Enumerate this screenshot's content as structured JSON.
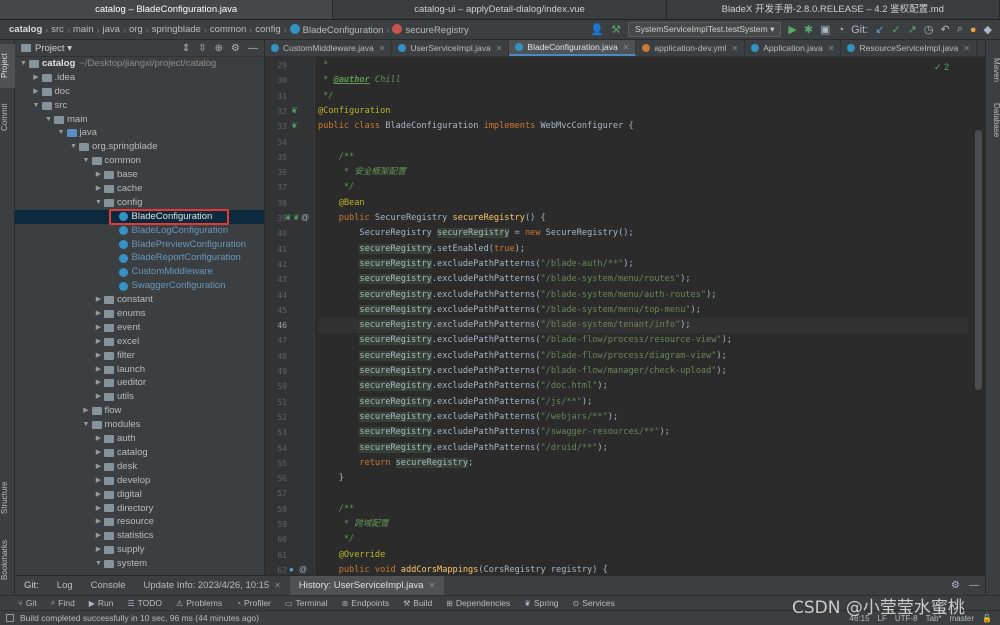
{
  "title_bar": {
    "windows": [
      {
        "label": "catalog – BladeConfiguration.java",
        "active": true
      },
      {
        "label": "catalog-ui – applyDetail-dialog/index.vue",
        "active": false
      },
      {
        "label": "BladeX 开发手册-2.8.0.RELEASE – 4.2 鉴权配置.md",
        "active": false
      }
    ]
  },
  "nav_bar": {
    "breadcrumbs": [
      "catalog",
      "src",
      "main",
      "java",
      "org",
      "springblade",
      "common",
      "config",
      "BladeConfiguration",
      "secureRegistry"
    ],
    "run_config": "SystemServiceImplTest.testSystem",
    "git_label": "Git:"
  },
  "project_panel": {
    "header_label": "Project",
    "tree": [
      {
        "label": "catalog",
        "path": "~/Desktop/jiangxi/project/catalog",
        "type": "folder",
        "depth": 0,
        "expanded": true
      },
      {
        "label": ".idea",
        "type": "folder",
        "depth": 1,
        "expanded": false
      },
      {
        "label": "doc",
        "type": "folder",
        "depth": 1,
        "expanded": false
      },
      {
        "label": "src",
        "type": "folder",
        "depth": 1,
        "expanded": true
      },
      {
        "label": "main",
        "type": "folder",
        "depth": 2,
        "expanded": true
      },
      {
        "label": "java",
        "type": "folder-blue",
        "depth": 3,
        "expanded": true
      },
      {
        "label": "org.springblade",
        "type": "folder",
        "depth": 4,
        "expanded": true
      },
      {
        "label": "common",
        "type": "folder",
        "depth": 5,
        "expanded": true
      },
      {
        "label": "base",
        "type": "folder",
        "depth": 6,
        "expanded": false
      },
      {
        "label": "cache",
        "type": "folder",
        "depth": 6,
        "expanded": false
      },
      {
        "label": "config",
        "type": "folder",
        "depth": 6,
        "expanded": true
      },
      {
        "label": "BladeConfiguration",
        "type": "class",
        "depth": 7,
        "selected": true
      },
      {
        "label": "BladeLogConfiguration",
        "type": "class",
        "depth": 7
      },
      {
        "label": "BladePreviewConfiguration",
        "type": "class",
        "depth": 7
      },
      {
        "label": "BladeReportConfiguration",
        "type": "class",
        "depth": 7
      },
      {
        "label": "CustomMiddleware",
        "type": "class",
        "depth": 7
      },
      {
        "label": "SwaggerConfiguration",
        "type": "class",
        "depth": 7
      },
      {
        "label": "constant",
        "type": "folder",
        "depth": 6,
        "expanded": false
      },
      {
        "label": "enums",
        "type": "folder",
        "depth": 6,
        "expanded": false
      },
      {
        "label": "event",
        "type": "folder",
        "depth": 6,
        "expanded": false
      },
      {
        "label": "excel",
        "type": "folder",
        "depth": 6,
        "expanded": false
      },
      {
        "label": "filter",
        "type": "folder",
        "depth": 6,
        "expanded": false
      },
      {
        "label": "launch",
        "type": "folder",
        "depth": 6,
        "expanded": false
      },
      {
        "label": "ueditor",
        "type": "folder",
        "depth": 6,
        "expanded": false
      },
      {
        "label": "utils",
        "type": "folder",
        "depth": 6,
        "expanded": false
      },
      {
        "label": "flow",
        "type": "folder",
        "depth": 5,
        "expanded": false
      },
      {
        "label": "modules",
        "type": "folder",
        "depth": 5,
        "expanded": true
      },
      {
        "label": "auth",
        "type": "folder",
        "depth": 6,
        "expanded": false
      },
      {
        "label": "catalog",
        "type": "folder",
        "depth": 6,
        "expanded": false
      },
      {
        "label": "desk",
        "type": "folder",
        "depth": 6,
        "expanded": false
      },
      {
        "label": "develop",
        "type": "folder",
        "depth": 6,
        "expanded": false
      },
      {
        "label": "digital",
        "type": "folder",
        "depth": 6,
        "expanded": false
      },
      {
        "label": "directory",
        "type": "folder",
        "depth": 6,
        "expanded": false
      },
      {
        "label": "resource",
        "type": "folder",
        "depth": 6,
        "expanded": false
      },
      {
        "label": "statistics",
        "type": "folder",
        "depth": 6,
        "expanded": false
      },
      {
        "label": "supply",
        "type": "folder",
        "depth": 6,
        "expanded": false
      },
      {
        "label": "system",
        "type": "folder",
        "depth": 6,
        "expanded": true
      }
    ]
  },
  "editor": {
    "tabs": [
      {
        "label": "CustomMiddleware.java",
        "color": "#3592c4",
        "active": false
      },
      {
        "label": "UserServiceImpl.java",
        "color": "#3592c4",
        "active": false
      },
      {
        "label": "BladeConfiguration.java",
        "color": "#3592c4",
        "active": true
      },
      {
        "label": "application-dev.yml",
        "color": "#cc7832",
        "active": false
      },
      {
        "label": "Application.java",
        "color": "#3592c4",
        "active": false
      },
      {
        "label": "ResourceServiceImpl.java",
        "color": "#3592c4",
        "active": false
      }
    ],
    "inspection_badge": "✓ 2",
    "current_line": 46,
    "lines": [
      {
        "n": 29,
        "html": "<span class=\"c\"> *</span>"
      },
      {
        "n": 30,
        "html": "<span class=\"c\"> * </span><span class=\"ct\">@author</span><span class=\"c\"> Chill</span>"
      },
      {
        "n": 31,
        "html": "<span class=\"c\"> */</span>"
      },
      {
        "n": 32,
        "html": "<span class=\"a\">@Configuration</span>"
      },
      {
        "n": 33,
        "html": "<span class=\"k\">public class </span>BladeConfiguration <span class=\"k\">implements </span>WebMvcConfigurer {"
      },
      {
        "n": 34,
        "html": ""
      },
      {
        "n": 35,
        "html": "    <span class=\"c\">/**</span>"
      },
      {
        "n": 36,
        "html": "    <span class=\"c\"> * 安全框架配置</span>"
      },
      {
        "n": 37,
        "html": "    <span class=\"c\"> */</span>"
      },
      {
        "n": 38,
        "html": "    <span class=\"a\">@Bean</span>"
      },
      {
        "n": 39,
        "html": "    <span class=\"k\">public </span>SecureRegistry <span class=\"m\">secureRegistry</span>() {"
      },
      {
        "n": 40,
        "html": "        SecureRegistry <span class=\"v\">secureRegistry</span> = <span class=\"k\">new </span>SecureRegistry();"
      },
      {
        "n": 41,
        "html": "        <span class=\"v\">secureRegistry</span>.setEnabled(<span class=\"k\">true</span>);"
      },
      {
        "n": 42,
        "html": "        <span class=\"v\">secureRegistry</span>.excludePathPatterns(<span class=\"s\">\"/blade-auth/**\"</span>);"
      },
      {
        "n": 43,
        "html": "        <span class=\"v\">secureRegistry</span>.excludePathPatterns(<span class=\"s\">\"/blade-system/menu/routes\"</span>);"
      },
      {
        "n": 44,
        "html": "        <span class=\"v\">secureRegistry</span>.excludePathPatterns(<span class=\"s\">\"/blade-system/menu/auth-routes\"</span>);"
      },
      {
        "n": 45,
        "html": "        <span class=\"v\">secureRegistry</span>.excludePathPatterns(<span class=\"s\">\"/blade-system/menu/top-menu\"</span>);"
      },
      {
        "n": 46,
        "html": "        <span class=\"v\">secureRegistry</span>.excludePathPatterns(<span class=\"s\">\"/blade-system/tenant/info\"</span>);"
      },
      {
        "n": 47,
        "html": "        <span class=\"v\">secureRegistry</span>.excludePathPatterns(<span class=\"s\">\"/blade-flow/process/resource-view\"</span>);"
      },
      {
        "n": 48,
        "html": "        <span class=\"v\">secureRegistry</span>.excludePathPatterns(<span class=\"s\">\"/blade-flow/process/diagram-view\"</span>);"
      },
      {
        "n": 49,
        "html": "        <span class=\"v\">secureRegistry</span>.excludePathPatterns(<span class=\"s\">\"/blade-flow/manager/check-upload\"</span>);"
      },
      {
        "n": 50,
        "html": "        <span class=\"v\">secureRegistry</span>.excludePathPatterns(<span class=\"s\">\"/doc.html\"</span>);"
      },
      {
        "n": 51,
        "html": "        <span class=\"v\">secureRegistry</span>.excludePathPatterns(<span class=\"s\">\"/js/**\"</span>);"
      },
      {
        "n": 52,
        "html": "        <span class=\"v\">secureRegistry</span>.excludePathPatterns(<span class=\"s\">\"/webjars/**\"</span>);"
      },
      {
        "n": 53,
        "html": "        <span class=\"v\">secureRegistry</span>.excludePathPatterns(<span class=\"s\">\"/swagger-resources/**\"</span>);"
      },
      {
        "n": 54,
        "html": "        <span class=\"v\">secureRegistry</span>.excludePathPatterns(<span class=\"s\">\"/druid/**\"</span>);"
      },
      {
        "n": 55,
        "html": "        <span class=\"k\">return </span><span class=\"v\">secureRegistry</span>;"
      },
      {
        "n": 56,
        "html": "    }"
      },
      {
        "n": 57,
        "html": ""
      },
      {
        "n": 58,
        "html": "    <span class=\"c\">/**</span>"
      },
      {
        "n": 59,
        "html": "    <span class=\"c\"> * 跨域配置</span>"
      },
      {
        "n": 60,
        "html": "    <span class=\"c\"> */</span>"
      },
      {
        "n": 61,
        "html": "    <span class=\"a\">@Override</span>"
      },
      {
        "n": 62,
        "html": "    <span class=\"k\">public void </span><span class=\"m\">addCorsMappings</span>(CorsRegistry registry) {"
      }
    ]
  },
  "left_strip": {
    "project": "Project",
    "commit": "Commit",
    "structure": "Structure",
    "bookmarks": "Bookmarks"
  },
  "right_strip": {
    "maven": "Maven",
    "database": "Database"
  },
  "bottom_tabs": {
    "git": "Git:",
    "log": "Log",
    "console": "Console",
    "update_info": "Update Info: 2023/4/26, 10:15",
    "history": "History: UserServiceImpl.java"
  },
  "tool_strip": [
    "Git",
    "Find",
    "Run",
    "TODO",
    "Problems",
    "Profiler",
    "Terminal",
    "Endpoints",
    "Build",
    "Dependencies",
    "Spring",
    "Services"
  ],
  "status_bar": {
    "message": "Build completed successfully in 10 sec, 96 ms (44 minutes ago)",
    "position": "46:15",
    "line_sep": "LF",
    "encoding": "UTF-8",
    "indent": "Tab*",
    "branch": "master"
  },
  "watermark": "CSDN @小莹莹水蜜桃"
}
